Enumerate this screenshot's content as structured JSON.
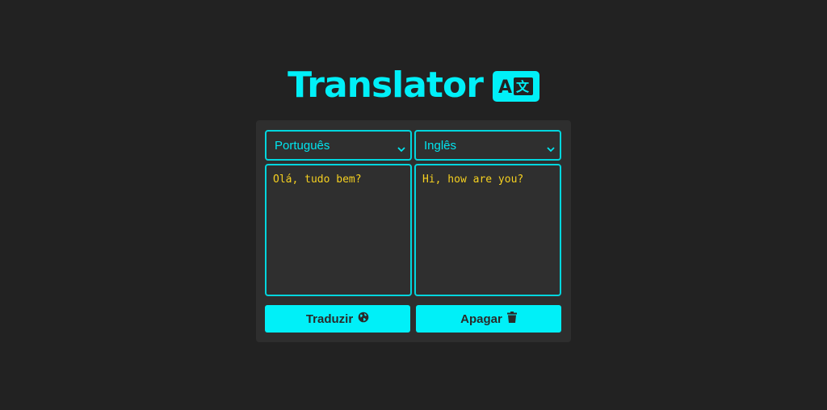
{
  "header": {
    "title": "Translator",
    "icon": "translate-icon"
  },
  "source": {
    "language": "Português",
    "text": "Olá, tudo bem?"
  },
  "target": {
    "language": "Inglês",
    "text": "Hi, how are you?"
  },
  "actions": {
    "translate_label": "Traduzir",
    "translate_icon": "globe-icon",
    "clear_label": "Apagar",
    "clear_icon": "trash-icon"
  },
  "colors": {
    "background": "#222222",
    "card": "#2e2e2e",
    "accent": "#00f0f8",
    "text_yellow": "#f5d020"
  }
}
